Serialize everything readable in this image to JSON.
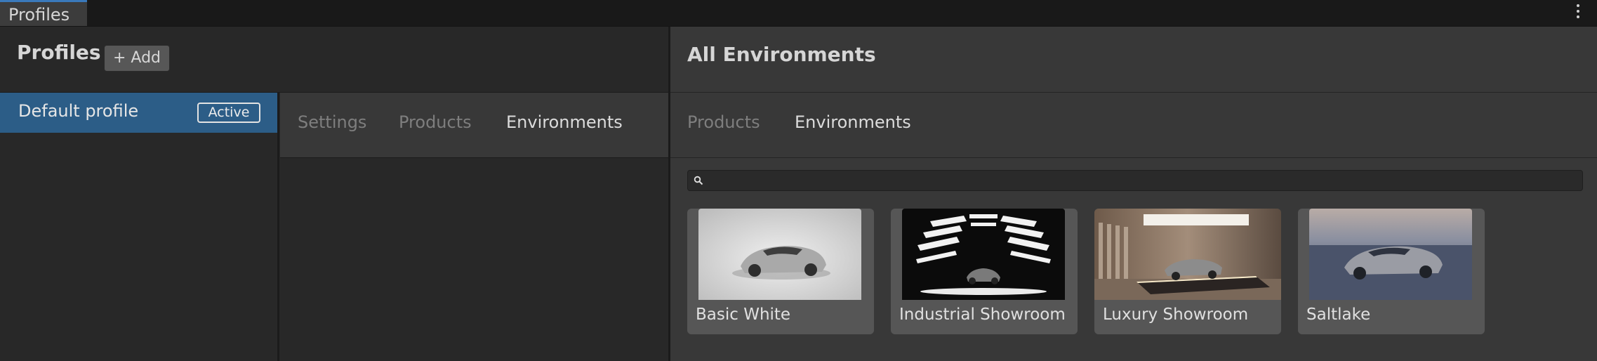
{
  "window": {
    "tab_label": "Profiles",
    "menu_icon": "kebab-vertical-icon"
  },
  "profiles_panel": {
    "title": "Profiles",
    "add_label": "+ Add",
    "items": [
      {
        "name": "Default profile",
        "badge": "Active",
        "selected": true
      }
    ],
    "detail_tabs": [
      {
        "label": "Settings",
        "selected": false
      },
      {
        "label": "Products",
        "selected": false
      },
      {
        "label": "Environments",
        "selected": true
      }
    ]
  },
  "environments_panel": {
    "title": "All Environments",
    "tabs": [
      {
        "label": "Products",
        "selected": false
      },
      {
        "label": "Environments",
        "selected": true
      }
    ],
    "search": {
      "value": "",
      "placeholder": "",
      "icon": "search-icon"
    },
    "items": [
      {
        "label": "Basic White",
        "thumbnail": "white-studio-car"
      },
      {
        "label": "Industrial Showroom",
        "thumbnail": "dark-lighttunnel-car"
      },
      {
        "label": "Luxury Showroom",
        "thumbnail": "warm-showroom-car"
      },
      {
        "label": "Saltlake",
        "thumbnail": "saltflat-dusk-car"
      }
    ]
  },
  "colors": {
    "selection": "#2c5d87",
    "accent": "#3a79bb",
    "panel": "#383838",
    "background": "#282828"
  }
}
